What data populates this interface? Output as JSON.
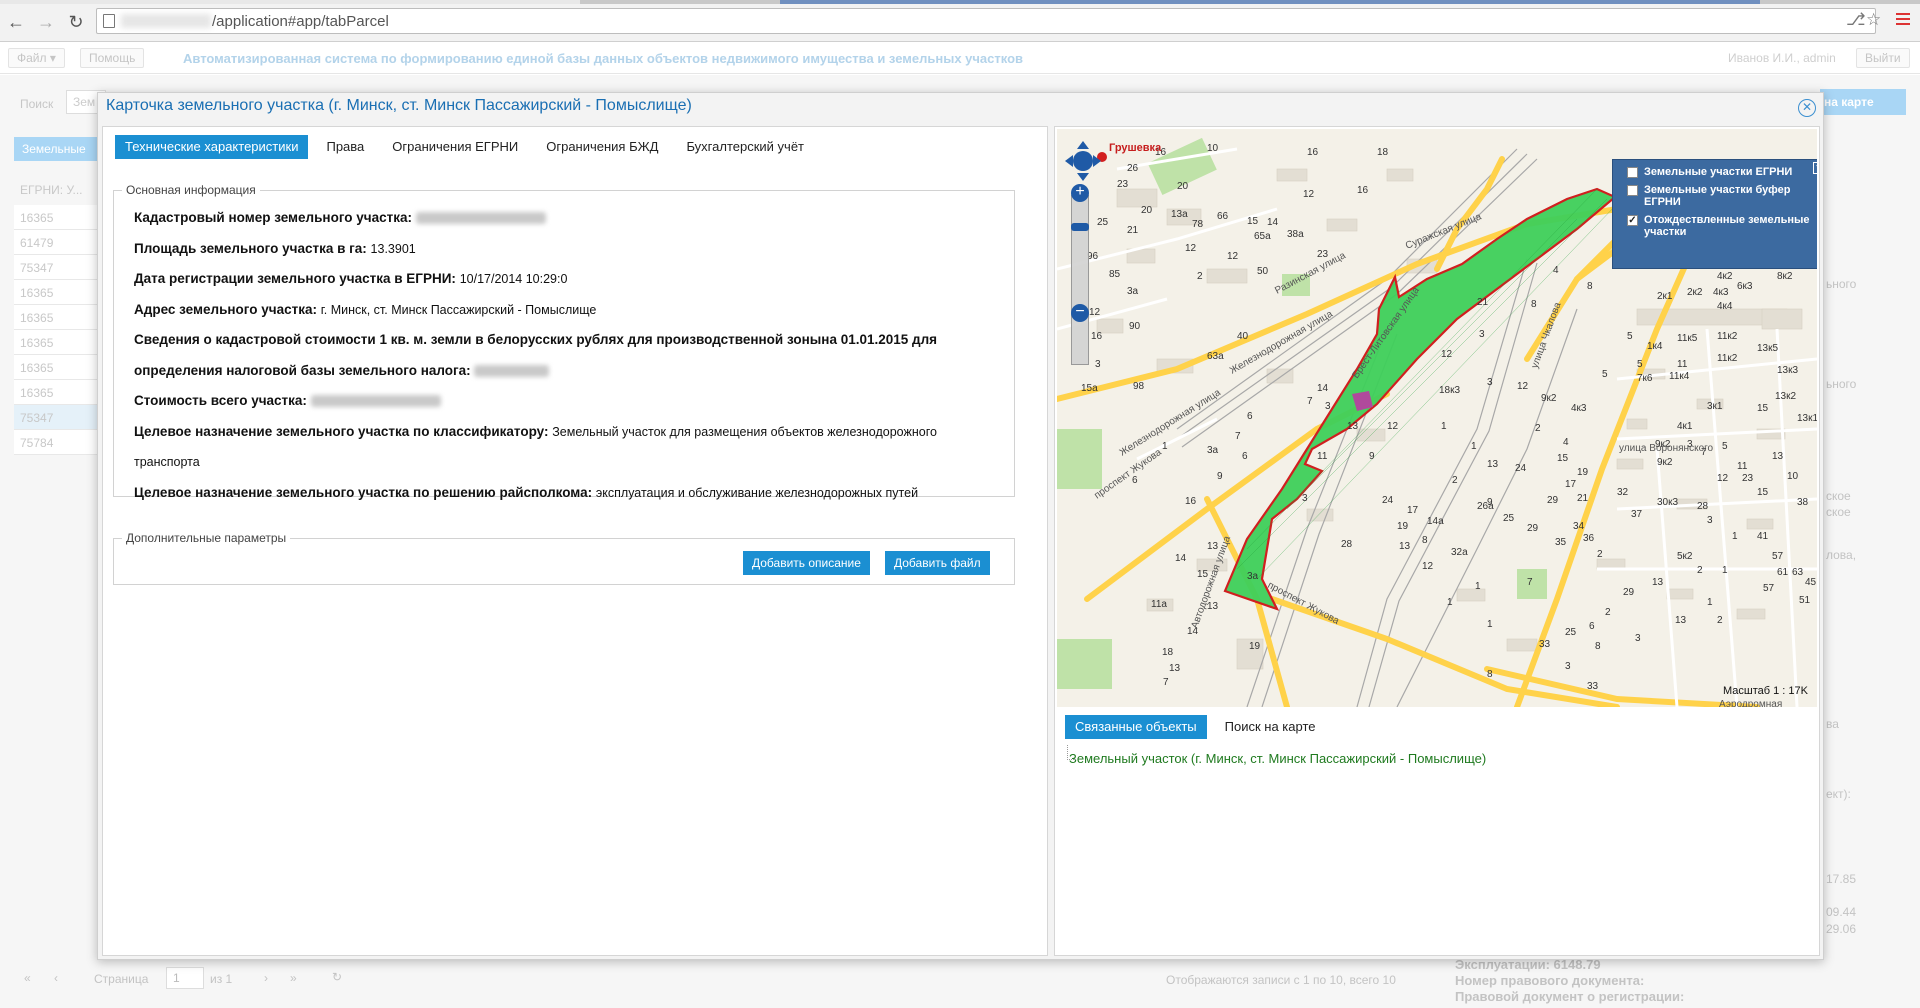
{
  "browser": {
    "url": "/application#app/tabParcel"
  },
  "header": {
    "file_menu": "Файл",
    "help_menu": "Помощь",
    "app_title": "Автоматизированная система по формированию единой базы данных объектов недвижимого имущества и земельных участков",
    "user": "Иванов И.И., admin",
    "logout": "Выйти"
  },
  "background": {
    "search_label": "Поиск",
    "search_value": "Зем",
    "tab_label": "Земельные",
    "list_header": "ЕГРНИ: У...",
    "list_rows": [
      "16365",
      "61479",
      "75347",
      "16365",
      "16365",
      "16365",
      "16365",
      "16365",
      "75347",
      "75784"
    ],
    "map_button": "на карте",
    "right_texts": [
      "ьного",
      "ьного",
      "ское",
      "ское",
      "лова,",
      "ва",
      "ект):",
      "17.85",
      "09.44",
      "29.06"
    ],
    "pager_label": "Страница",
    "pager_value": "1",
    "pager_of": "из 1",
    "status": "Отображаются записи с 1 по 10, всего 10",
    "bottom_lines": [
      "Эксплуатации: 6148.79",
      "Номер правового документа:",
      "Правовой документ о регистрации:"
    ]
  },
  "modal": {
    "title": "Карточка земельного участка (г. Минск, ст. Минск Пассажирский - Помыслище)",
    "tabs": [
      {
        "label": "Технические характеристики",
        "active": true
      },
      {
        "label": "Права",
        "active": false
      },
      {
        "label": "Ограничения ЕГРНИ",
        "active": false
      },
      {
        "label": "Ограничения БЖД",
        "active": false
      },
      {
        "label": "Бухгалтерский учёт",
        "active": false
      }
    ],
    "main_legend": "Основная информация",
    "fields": {
      "cadastral_label": "Кадастровый номер земельного участка:",
      "area_label": "Площадь земельного участка в га:",
      "area_value": "13.3901",
      "reg_date_label": "Дата регистрации земельного участка в ЕГРНИ:",
      "reg_date_value": "10/17/2014 10:29:0",
      "address_label": "Адрес земельного участка:",
      "address_value": "г. Минск, ст. Минск Пассажирский - Помыслище",
      "cadastral_cost_label_1": "Сведения о кадастровой стоимости 1 кв. м. земли в белорусских рублях для производственной зонына 01.01.2015 для",
      "cadastral_cost_label_2": "определения налоговой базы земельного налога:",
      "total_cost_label": "Стоимость всего участка:",
      "purpose_class_label": "Целевое назначение земельного участка по классификатору:",
      "purpose_class_value_1": "Земельный участок для размещения объектов железнодорожного",
      "purpose_class_value_2": "транспорта",
      "purpose_decision_label": "Целевое назначение земельного участка по решению райсполкома:",
      "purpose_decision_value": "эксплуатация и обслуживание железнодорожных путей"
    },
    "extra_legend": "Дополнительные параметры",
    "add_description": "Добавить описание",
    "add_file": "Добавить файл",
    "map": {
      "layers": [
        {
          "label": "Земельные участки ЕГРНИ",
          "checked": false
        },
        {
          "label": "Земельные участки буфер ЕГРНИ",
          "checked": false
        },
        {
          "label": "Отождествленные земельные участки",
          "checked": true
        }
      ],
      "scale_label": "Масштаб 1 : 17K",
      "place_labels": {
        "grushevka": "Грушевка",
        "surazhskaya": "Суражская улица",
        "razinskaya": "Разинская улица",
        "brest": "Брест-Литовская улица",
        "zhukova": "проспект Жукова",
        "voronyanskogo": "улица Воронянского",
        "chkalova": "улица Чкалова",
        "aerodromnaya": "Аэродромная",
        "zheleznodorozhnaya": "Железнодорожная улица",
        "avtodorozhnaya": "Автодорожная улица"
      },
      "colors": {
        "parcel_fill": "#3ecf5a",
        "parcel_stroke": "#d01f1f",
        "road": "#ffd24a",
        "layer_panel": "#3c6aa0"
      }
    },
    "related_tabs": [
      {
        "label": "Связанные объекты",
        "active": true
      },
      {
        "label": "Поиск на карте",
        "active": false
      }
    ],
    "related_item": "Земельный участок (г. Минск, ст. Минск Пассажирский - Помыслище)"
  }
}
